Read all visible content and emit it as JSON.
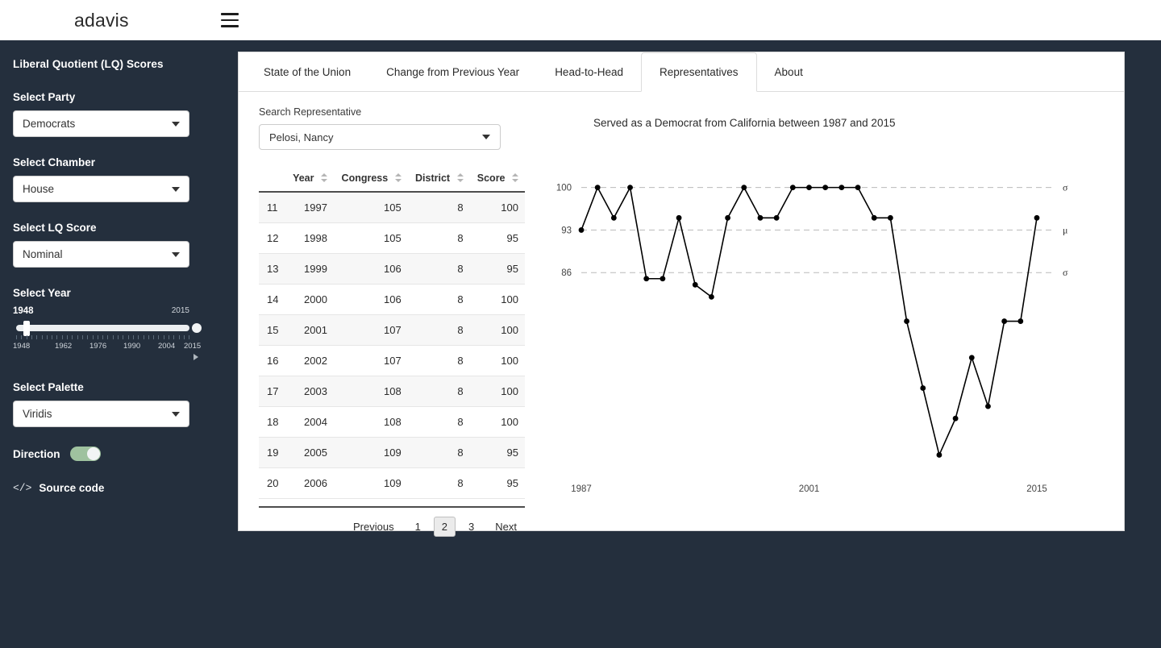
{
  "topbar": {
    "brand": "adavis",
    "menu_icon": "hamburger-icon"
  },
  "sidebar": {
    "title": "Liberal Quotient (LQ) Scores",
    "fields": [
      {
        "label": "Select Party",
        "value": "Democrats"
      },
      {
        "label": "Select Chamber",
        "value": "House"
      },
      {
        "label": "Select LQ Score",
        "value": "Nominal"
      }
    ],
    "year": {
      "label": "Select Year",
      "value_low": "1948",
      "value_high": "2015",
      "scale": [
        "1948",
        "1962",
        "1976",
        "1990",
        "2004",
        "2015"
      ]
    },
    "palette": {
      "label": "Select Palette",
      "value": "Viridis"
    },
    "direction": {
      "label": "Direction",
      "state": "on"
    },
    "source": {
      "label": "Source code",
      "icon": "</>"
    }
  },
  "tabs": [
    {
      "label": "State of the Union",
      "active": false
    },
    {
      "label": "Change from Previous Year",
      "active": false
    },
    {
      "label": "Head-to-Head",
      "active": false
    },
    {
      "label": "Representatives",
      "active": true
    },
    {
      "label": "About",
      "active": false
    }
  ],
  "search": {
    "label": "Search Representative",
    "value": "Pelosi, Nancy"
  },
  "table": {
    "columns": [
      "Year",
      "Congress",
      "District",
      "Score"
    ],
    "rows": [
      {
        "idx": "11",
        "year": "1997",
        "congress": "105",
        "district": "8",
        "score": "100"
      },
      {
        "idx": "12",
        "year": "1998",
        "congress": "105",
        "district": "8",
        "score": "95"
      },
      {
        "idx": "13",
        "year": "1999",
        "congress": "106",
        "district": "8",
        "score": "95"
      },
      {
        "idx": "14",
        "year": "2000",
        "congress": "106",
        "district": "8",
        "score": "100"
      },
      {
        "idx": "15",
        "year": "2001",
        "congress": "107",
        "district": "8",
        "score": "100"
      },
      {
        "idx": "16",
        "year": "2002",
        "congress": "107",
        "district": "8",
        "score": "100"
      },
      {
        "idx": "17",
        "year": "2003",
        "congress": "108",
        "district": "8",
        "score": "100"
      },
      {
        "idx": "18",
        "year": "2004",
        "congress": "108",
        "district": "8",
        "score": "100"
      },
      {
        "idx": "19",
        "year": "2005",
        "congress": "109",
        "district": "8",
        "score": "95"
      },
      {
        "idx": "20",
        "year": "2006",
        "congress": "109",
        "district": "8",
        "score": "95"
      }
    ]
  },
  "pagination": {
    "previous": "Previous",
    "pages": [
      "1",
      "2",
      "3"
    ],
    "active": "2",
    "next": "Next"
  },
  "summary": "Served as a Democrat from California between 1987 and 2015",
  "chart_data": {
    "type": "line",
    "title": "",
    "xlabel": "",
    "ylabel": "",
    "xticks": [
      "1987",
      "2001",
      "2015"
    ],
    "yticks": [
      "100",
      "93",
      "86"
    ],
    "right_labels": [
      "σ",
      "μ",
      "σ"
    ],
    "ylim": [
      55,
      103
    ],
    "xlim": [
      1987,
      2015
    ],
    "grid": "dashed-horizontal",
    "legend": "none",
    "marker": "circle",
    "line_color": "#000000",
    "x": [
      1987,
      1988,
      1989,
      1990,
      1991,
      1992,
      1993,
      1994,
      1995,
      1996,
      1997,
      1998,
      1999,
      2000,
      2001,
      2002,
      2003,
      2004,
      2005,
      2006,
      2007,
      2008,
      2009,
      2010,
      2011,
      2012,
      2013,
      2014,
      2015
    ],
    "values": [
      93,
      100,
      95,
      100,
      85,
      85,
      95,
      84,
      82,
      95,
      100,
      95,
      95,
      100,
      100,
      100,
      100,
      100,
      95,
      95,
      78,
      67,
      56,
      62,
      72,
      64,
      78,
      78,
      95
    ]
  }
}
